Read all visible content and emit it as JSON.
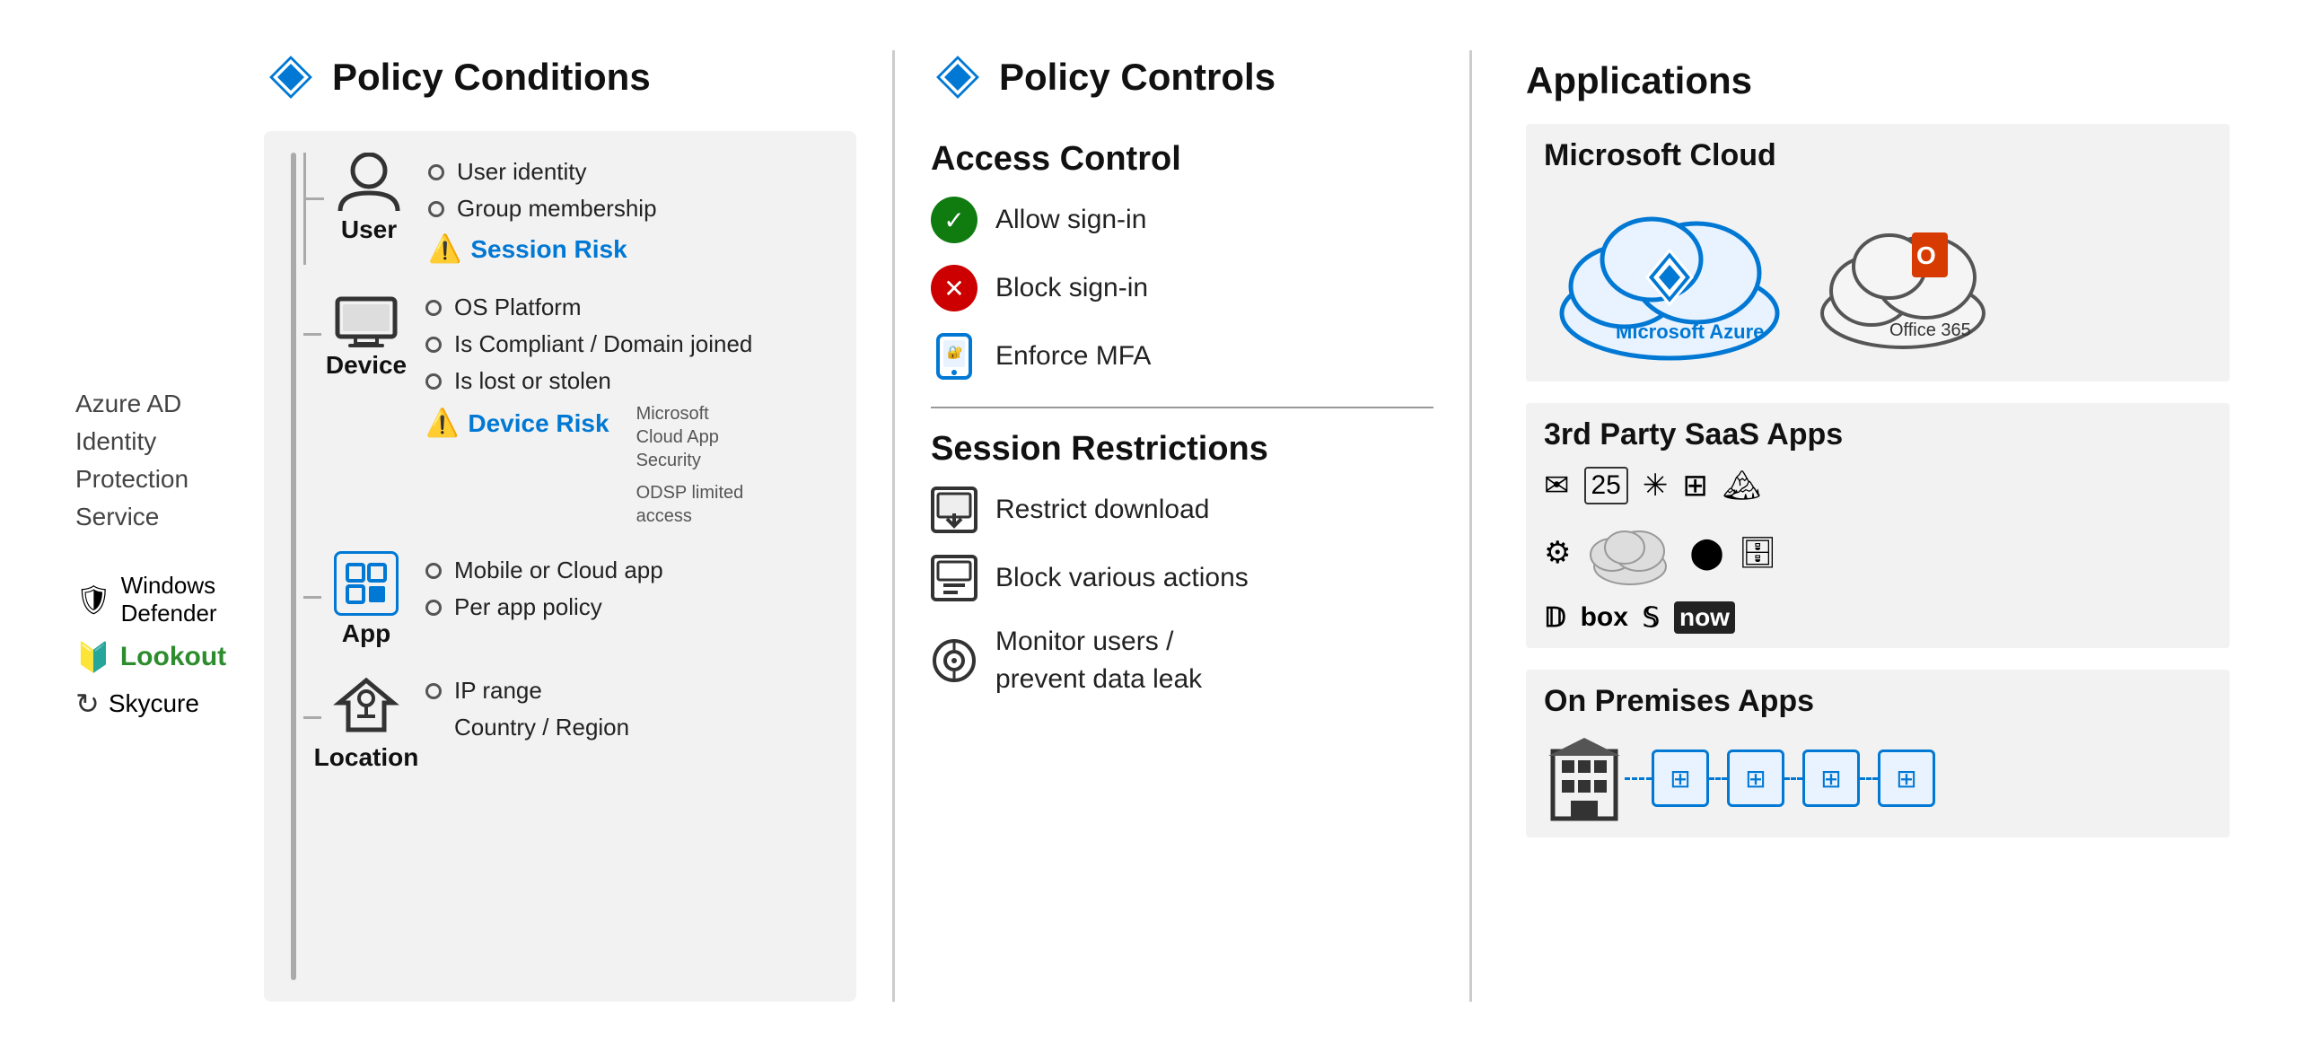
{
  "header": {
    "policy_conditions_title": "Policy Conditions",
    "policy_controls_title": "Policy Controls",
    "applications_title": "Applications"
  },
  "left_sidebar": {
    "azure_ad_text": "Azure AD\nIdentity\nProtection\nService",
    "defenders": [
      {
        "icon": "🛡",
        "label": "Windows Defender",
        "color": "#333"
      },
      {
        "icon": "🔰",
        "label": "Lookout",
        "color": "#2d8c2d"
      },
      {
        "icon": "↺",
        "label": "Skycure",
        "color": "#333"
      }
    ]
  },
  "policy_conditions": {
    "user_group": {
      "label": "User",
      "items": [
        "User identity",
        "Group membership"
      ],
      "risk_label": "Session Risk"
    },
    "device_group": {
      "label": "Device",
      "items": [
        "OS Platform",
        "Is Compliant / Domain joined",
        "Is lost or stolen"
      ],
      "risk_label": "Device Risk",
      "annotation1": "Microsoft\nCloud App\nSecurity",
      "annotation2": "ODSP limited\naccess"
    },
    "app_group": {
      "label": "App",
      "items": [
        "Mobile or Cloud app",
        "Per app policy"
      ]
    },
    "location_group": {
      "label": "Location",
      "items": [
        "IP range",
        "Country / Region"
      ]
    }
  },
  "policy_controls": {
    "access_control_title": "Access Control",
    "items": [
      {
        "icon": "allow",
        "label": "Allow sign-in"
      },
      {
        "icon": "block",
        "label": "Block sign-in"
      },
      {
        "icon": "mfa",
        "label": "Enforce MFA"
      }
    ],
    "session_restrictions_title": "Session Restrictions",
    "session_items": [
      {
        "icon": "download",
        "label": "Restrict download"
      },
      {
        "icon": "block_actions",
        "label": "Block various actions"
      },
      {
        "icon": "monitor",
        "label": "Monitor users /\nprevent data leak"
      }
    ]
  },
  "applications": {
    "microsoft_cloud_title": "Microsoft Cloud",
    "azure_label": "Microsoft Azure",
    "office365_label": "Office 365",
    "saas_title": "3rd Party SaaS Apps",
    "saas_apps": [
      "✉",
      "25",
      "✳",
      "⊞",
      "🏔",
      "⚙",
      "☁",
      "🔘",
      "👥",
      "🅱",
      "📦",
      "💧"
    ],
    "on_premises_title": "On Premises Apps",
    "proxy_count": 4
  }
}
